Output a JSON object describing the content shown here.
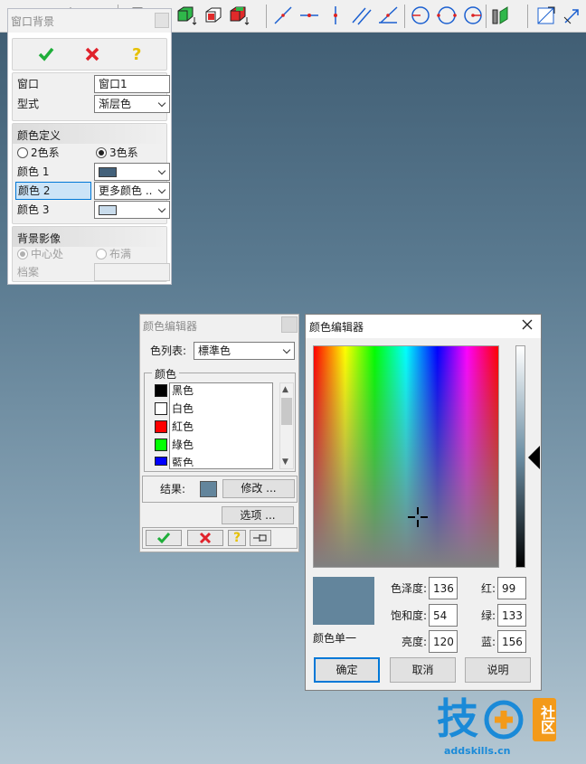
{
  "colors": {
    "accent": "#0078d7",
    "ok_green": "#1fae3a",
    "cancel_red": "#e0222b",
    "help_yellow": "#e6c000",
    "color1_swatch": "#43617a",
    "color3_swatch": "#c9dcec",
    "result_swatch": "#63859c",
    "preview_swatch": "#63859c",
    "logo_blue": "#1a8ad8",
    "logo_orange": "#f39a1a"
  },
  "toolbar": {
    "icons": [
      "book-icon",
      "arrow-icon",
      "cube-icon",
      "cube-green-icon",
      "cube-red-icon",
      "cube-arrow-icon",
      "line-icon",
      "line-mid-icon",
      "vertical-line-icon",
      "parallel-line-icon",
      "angle-line-icon",
      "circle-left-icon",
      "circle-icon",
      "circle-dot-icon",
      "wall-icon",
      "grid-icon",
      "cursor-icon"
    ]
  },
  "bg_panel": {
    "title": "窗口背景",
    "window_label": "窗口",
    "window_value": "窗口1",
    "style_label": "型式",
    "style_value": "渐层色",
    "color_def_title": "颜色定义",
    "radio_2": "2色系",
    "radio_3": "3色系",
    "color1_label": "颜色 1",
    "color2_label": "颜色 2",
    "color2_value": "更多颜色 ..",
    "color3_label": "颜色 3",
    "bg_image_title": "背景影像",
    "radio_center": "中心处",
    "radio_fill": "布满",
    "file_label": "档案"
  },
  "small_editor": {
    "title": "颜色编辑器",
    "list_label": "色列表:",
    "list_value": "標準色",
    "group_label": "颜色",
    "items": [
      {
        "name": "黑色",
        "color": "#000000"
      },
      {
        "name": "白色",
        "color": "#ffffff"
      },
      {
        "name": "紅色",
        "color": "#ff0000"
      },
      {
        "name": "綠色",
        "color": "#00ff00"
      },
      {
        "name": "藍色",
        "color": "#0000ff"
      }
    ],
    "result_label": "结果:",
    "modify_label": "修改 ...",
    "options_label": "选项 ..."
  },
  "large_editor": {
    "title": "颜色编辑器",
    "hue_label": "色泽度:",
    "hue_value": "136",
    "sat_label": "饱和度:",
    "sat_value": "54",
    "lum_label": "亮度:",
    "lum_value": "120",
    "red_label": "红:",
    "red_value": "99",
    "green_label": "绿:",
    "green_value": "133",
    "blue_label": "蓝:",
    "blue_value": "156",
    "solid_label": "颜色单一",
    "ok_label": "确定",
    "cancel_label": "取消",
    "help_label": "说明"
  },
  "watermark": {
    "big": "技",
    "side": "社区",
    "url": "addskills.cn"
  }
}
